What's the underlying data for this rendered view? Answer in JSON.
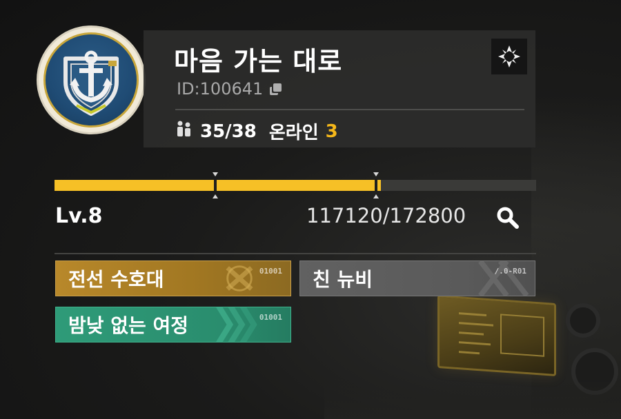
{
  "guild": {
    "name": "마음 가는 대로",
    "id_label": "ID:",
    "id_value": "100641",
    "members_label": "35/38",
    "online_label": "온라인",
    "online_count": "3"
  },
  "level": {
    "label": "Lv.8",
    "xp_current": 117120,
    "xp_max": 172800,
    "xp_text": "117120/172800",
    "progress_fraction": 0.6778
  },
  "tags": [
    {
      "label": "전선 수호대",
      "code": "01001",
      "color": "#b8882a"
    },
    {
      "label": "친 뉴비",
      "code": "/.0-R01",
      "color": "#616161"
    },
    {
      "label": "밤낮 없는 여정",
      "code": "01001",
      "color": "#2e9b78"
    }
  ],
  "icons": {
    "emblem": "anchor-shield-emblem",
    "members": "members-icon",
    "target": "crosshair-icon",
    "search": "search-icon",
    "copy": "copy-icon"
  },
  "colors": {
    "accent": "#f6c026",
    "online": "#f6b81a"
  }
}
